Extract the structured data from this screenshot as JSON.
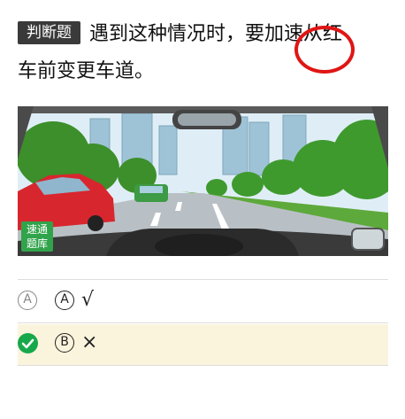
{
  "question": {
    "tag": "判断题",
    "line1": "遇到这种情况时，要加速从红",
    "line2": "车前变更车道。"
  },
  "image": {
    "watermark_line1": "速通",
    "watermark_line2": "题库"
  },
  "options": [
    {
      "marker": "A",
      "letter": "A",
      "text": "√",
      "selected": false
    },
    {
      "marker": "check",
      "letter": "B",
      "text": "×",
      "selected": true
    }
  ],
  "colors": {
    "tag_bg": "#3a3a3a",
    "annotation_circle": "#e01515",
    "correct_check": "#17a84a",
    "correct_row_bg": "#fbf4dd",
    "watermark_bg": "#31a34b"
  }
}
